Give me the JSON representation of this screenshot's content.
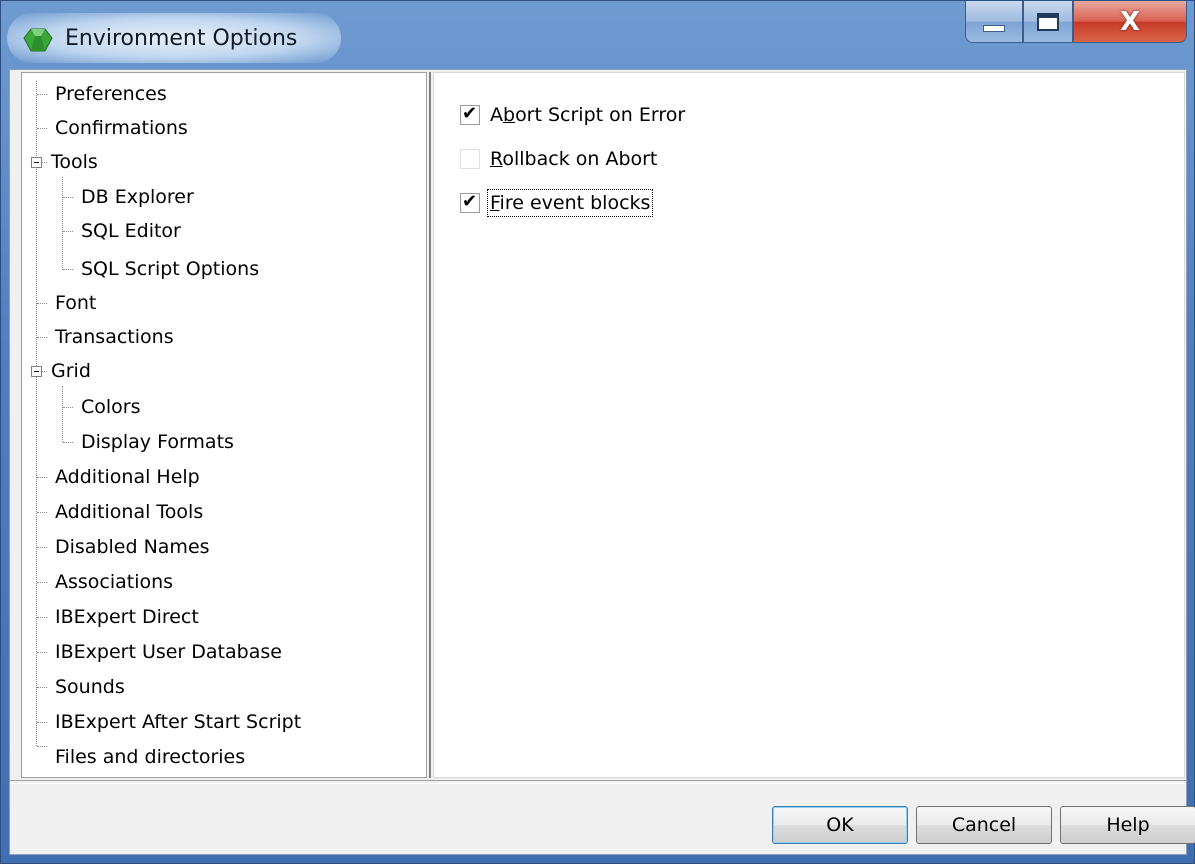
{
  "window": {
    "title": "Environment Options",
    "icon": "green-gem-icon",
    "caption_buttons": {
      "minimize_icon": "minimize-icon",
      "maximize_icon": "maximize-icon",
      "close_label": "X"
    }
  },
  "tree": {
    "items": [
      {
        "label": "Preferences"
      },
      {
        "label": "Confirmations"
      },
      {
        "label": "Tools",
        "expanded": true,
        "children": [
          {
            "label": "DB Explorer"
          },
          {
            "label": "SQL Editor"
          },
          {
            "label": "SQL Script Options"
          }
        ]
      },
      {
        "label": "Font"
      },
      {
        "label": "Transactions"
      },
      {
        "label": "Grid",
        "expanded": true,
        "children": [
          {
            "label": "Colors"
          },
          {
            "label": "Display Formats"
          }
        ]
      },
      {
        "label": "Additional Help"
      },
      {
        "label": "Additional Tools"
      },
      {
        "label": "Disabled Names"
      },
      {
        "label": "Associations"
      },
      {
        "label": "IBExpert Direct"
      },
      {
        "label": "IBExpert User Database"
      },
      {
        "label": "Sounds"
      },
      {
        "label": "IBExpert After Start Script"
      },
      {
        "label": "Files and directories"
      }
    ]
  },
  "options": [
    {
      "label_prefix": "A",
      "label_accel": "b",
      "label_rest": "ort Script on Error",
      "checked": true
    },
    {
      "label_prefix": "",
      "label_accel": "R",
      "label_rest": "ollback on Abort",
      "checked": false
    },
    {
      "label_prefix": "",
      "label_accel": "F",
      "label_rest": "ire event blocks",
      "checked": true
    }
  ],
  "buttons": {
    "ok": "OK",
    "cancel": "Cancel",
    "help": "Help"
  },
  "colors": {
    "title_bar": "#4f7fbf",
    "close_button": "#c63a26",
    "client_bg": "#f0f0f0"
  }
}
